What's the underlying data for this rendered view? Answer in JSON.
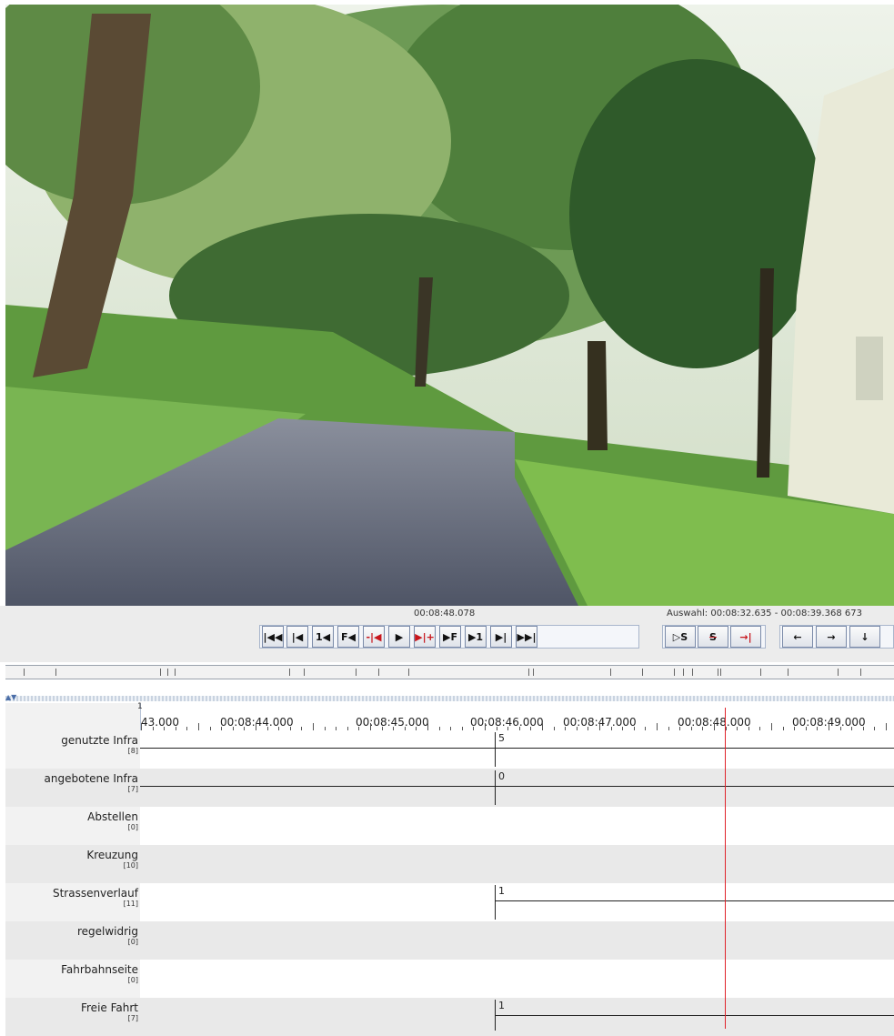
{
  "player": {
    "current_time": "00:08:48.078",
    "selection": "Auswahl: 00:08:32.635 - 00:08:39.368  673"
  },
  "transport": {
    "buttons": [
      {
        "name": "go-to-start-button",
        "glyph": "|◀◀"
      },
      {
        "name": "prev-frame-button",
        "glyph": "|◀"
      },
      {
        "name": "step-back-1-button",
        "glyph": "1◀"
      },
      {
        "name": "step-back-f-button",
        "glyph": "F◀"
      },
      {
        "name": "prev-marker-button",
        "glyph": "-|◀"
      },
      {
        "name": "play-button",
        "glyph": "▶"
      },
      {
        "name": "next-marker-button",
        "glyph": "▶|+"
      },
      {
        "name": "step-forward-f-button",
        "glyph": "▶F"
      },
      {
        "name": "step-forward-1-button",
        "glyph": "▶1"
      },
      {
        "name": "next-frame-button",
        "glyph": "▶|"
      },
      {
        "name": "go-to-end-button",
        "glyph": "▶▶|"
      }
    ],
    "selection_buttons": [
      {
        "name": "play-selection-button",
        "glyph": "▷S"
      },
      {
        "name": "clear-selection-button",
        "glyph": "S"
      },
      {
        "name": "jump-to-cursor-button",
        "glyph": "→|"
      }
    ],
    "nav_buttons": [
      {
        "name": "left-arrow-button",
        "glyph": "←"
      },
      {
        "name": "right-arrow-button",
        "glyph": "→"
      },
      {
        "name": "down-arrow-button",
        "glyph": "↓"
      }
    ]
  },
  "timeline": {
    "scale_first_label": "1",
    "ticks": [
      "43.000",
      "00:08:44.000",
      "00:08:45.000",
      "00:08:46.000",
      "00:08:47.000",
      "00:08:48.000",
      "00:08:49.000"
    ],
    "tiers": [
      {
        "name": "genutzte Infra",
        "count": "[8]",
        "value": "5"
      },
      {
        "name": "angebotene Infra",
        "count": "[7]",
        "value": "0"
      },
      {
        "name": "Abstellen",
        "count": "[0]",
        "value": ""
      },
      {
        "name": "Kreuzung",
        "count": "[10]",
        "value": ""
      },
      {
        "name": "Strassenverlauf",
        "count": "[11]",
        "value": "1"
      },
      {
        "name": "regelwidrig",
        "count": "[0]",
        "value": ""
      },
      {
        "name": "Fahrbahnseite",
        "count": "[0]",
        "value": ""
      },
      {
        "name": "Freie Fahrt",
        "count": "[7]",
        "value": "1"
      }
    ]
  },
  "colors": {
    "cursor": "#e0242b",
    "button_border": "#7a8aa8"
  }
}
